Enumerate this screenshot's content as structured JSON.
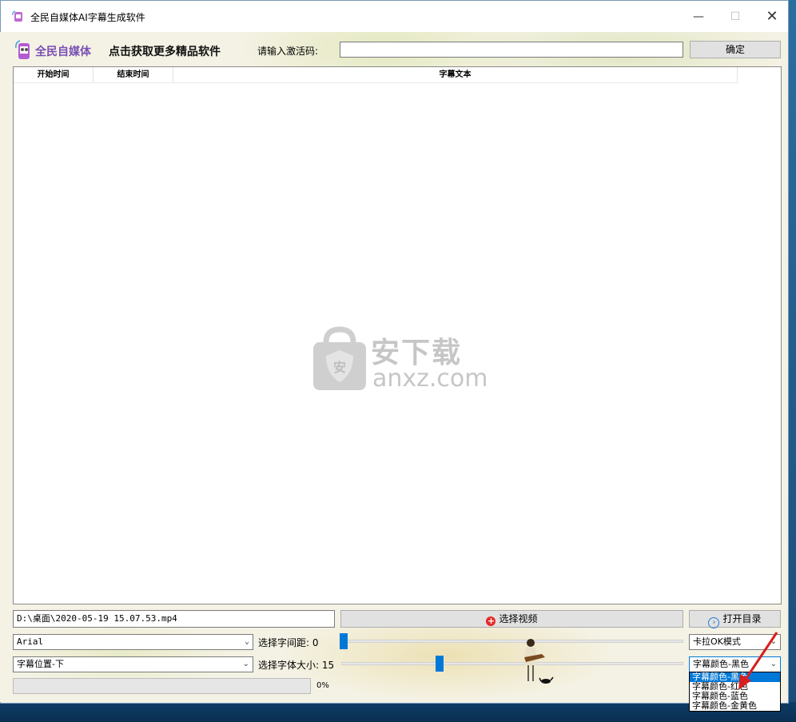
{
  "window": {
    "title": "全民自媒体AI字幕生成软件",
    "min_icon": "minimize-icon",
    "max_icon": "maximize-icon",
    "close_icon": "close-icon"
  },
  "header": {
    "logo_text": "全民自媒体",
    "promo_link": "点击获取更多精品软件",
    "activation_label": "请输入激活码:",
    "activation_value": "",
    "confirm_label": "确定"
  },
  "table": {
    "columns": [
      "开始时间",
      "结束时间",
      "字幕文本"
    ],
    "rows": []
  },
  "watermark": {
    "cn": "安下载",
    "en": "anxz.com"
  },
  "controls": {
    "video_path": "D:\\桌面\\2020-05-19 15.07.53.mp4",
    "select_video_label": "选择视频",
    "open_dir_label": "打开目录",
    "font": "Arial",
    "spacing_label": "选择字间距: 0",
    "spacing_value": 0,
    "mode": "卡拉OK模式",
    "position": "字幕位置-下",
    "size_label": "选择字体大小: 15",
    "size_value": 15,
    "color": "字幕颜色-黑色",
    "color_options": [
      "字幕颜色-黑色",
      "字幕颜色-红色",
      "字幕颜色-蓝色",
      "字幕颜色-金黄色"
    ],
    "progress_text": "0%",
    "progress_value": 0
  },
  "colors": {
    "accent": "#0078d7",
    "logo_purple": "#7a4fb4",
    "arrow_red": "#d81e1e"
  }
}
